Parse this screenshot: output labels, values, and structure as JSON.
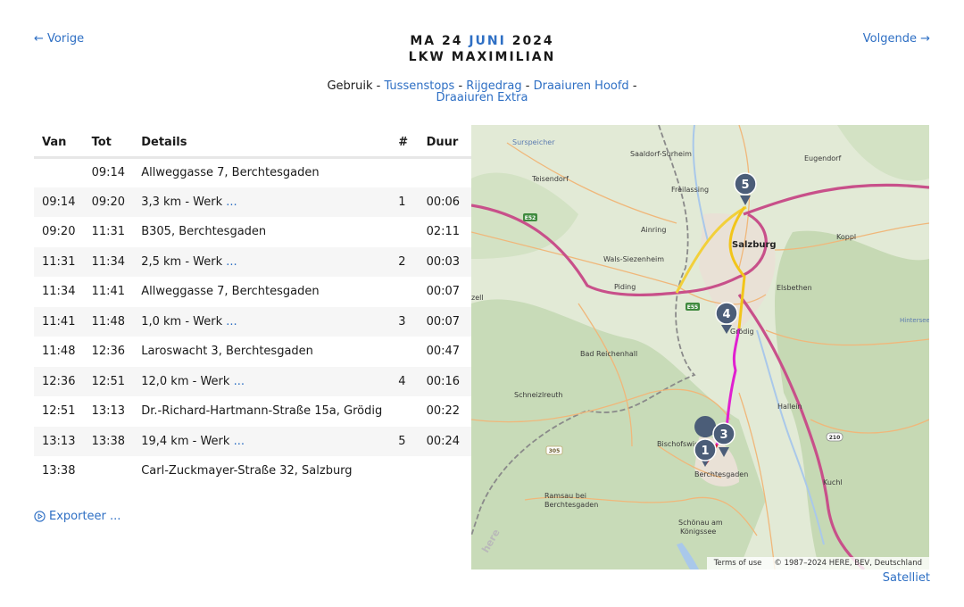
{
  "nav": {
    "prev": "← Vorige",
    "next": "Volgende →"
  },
  "header": {
    "day": "MA 24",
    "month": "JUNI",
    "year": "2024",
    "vehicle": "LKW MAXIMILIAN"
  },
  "usage": {
    "label": "Gebruik -",
    "links": [
      "Tussenstops",
      "Rijgedrag",
      "Draaiuren Hoofd",
      "Draaiuren Extra"
    ],
    "sep": "-"
  },
  "table": {
    "headers": [
      "Van",
      "Tot",
      "Details",
      "#",
      "Duur"
    ],
    "rows": [
      {
        "van": "",
        "tot": "09:14",
        "details": "Allweggasse 7, Berchtesgaden",
        "more": "",
        "num": "",
        "duur": ""
      },
      {
        "van": "09:14",
        "tot": "09:20",
        "details": "3,3 km - Werk",
        "more": "...",
        "num": "1",
        "duur": "00:06"
      },
      {
        "van": "09:20",
        "tot": "11:31",
        "details": "B305, Berchtesgaden",
        "more": "",
        "num": "",
        "duur": "02:11"
      },
      {
        "van": "11:31",
        "tot": "11:34",
        "details": "2,5 km - Werk",
        "more": "...",
        "num": "2",
        "duur": "00:03"
      },
      {
        "van": "11:34",
        "tot": "11:41",
        "details": "Allweggasse 7, Berchtesgaden",
        "more": "",
        "num": "",
        "duur": "00:07"
      },
      {
        "van": "11:41",
        "tot": "11:48",
        "details": "1,0 km - Werk",
        "more": "...",
        "num": "3",
        "duur": "00:07"
      },
      {
        "van": "11:48",
        "tot": "12:36",
        "details": "Laroswacht 3, Berchtesgaden",
        "more": "",
        "num": "",
        "duur": "00:47"
      },
      {
        "van": "12:36",
        "tot": "12:51",
        "details": "12,0 km - Werk",
        "more": "...",
        "num": "4",
        "duur": "00:16"
      },
      {
        "van": "12:51",
        "tot": "13:13",
        "details": "Dr.-Richard-Hartmann-Straße 15a, Grödig",
        "more": "",
        "num": "",
        "duur": "00:22"
      },
      {
        "van": "13:13",
        "tot": "13:38",
        "details": "19,4 km - Werk",
        "more": "...",
        "num": "5",
        "duur": "00:24"
      },
      {
        "van": "13:38",
        "tot": "",
        "details": "Carl-Zuckmayer-Straße 32, Salzburg",
        "more": "",
        "num": "",
        "duur": ""
      }
    ]
  },
  "export": {
    "label": "Exporteer ...",
    "icon": "play-circle-icon"
  },
  "map": {
    "places": [
      "Surspeicher",
      "Saaldorf-Surheim",
      "Teisendorf",
      "Freilassing",
      "Eugendorf",
      "Ainring",
      "Salzburg",
      "Koppl",
      "Wals-Siezenheim",
      "Piding",
      "Elsbethen",
      "zell",
      "Grödig",
      "Hintersee",
      "Bad Reichenhall",
      "Schneizlreuth",
      "Hallein",
      "Bischofswiesen",
      "Berchtesgaden",
      "Kuchl",
      "Ramsau bei",
      "Berchtesgaden",
      "Schönau am",
      "Königssee"
    ],
    "road_labels": [
      "E52",
      "E55",
      "305",
      "210"
    ],
    "markers": [
      "1",
      "3",
      "4",
      "5"
    ],
    "terms": "Terms of use",
    "copyright": "© 1987–2024 HERE, BEV, Deutschland",
    "watermark": "here",
    "colors": {
      "route_magenta": "#e020d0",
      "route_yellow": "#f2c51a",
      "route_red": "#d01c2e",
      "marker": "#4b5d78",
      "highway": "#c85a8e"
    }
  },
  "satellite": "Satelliet"
}
